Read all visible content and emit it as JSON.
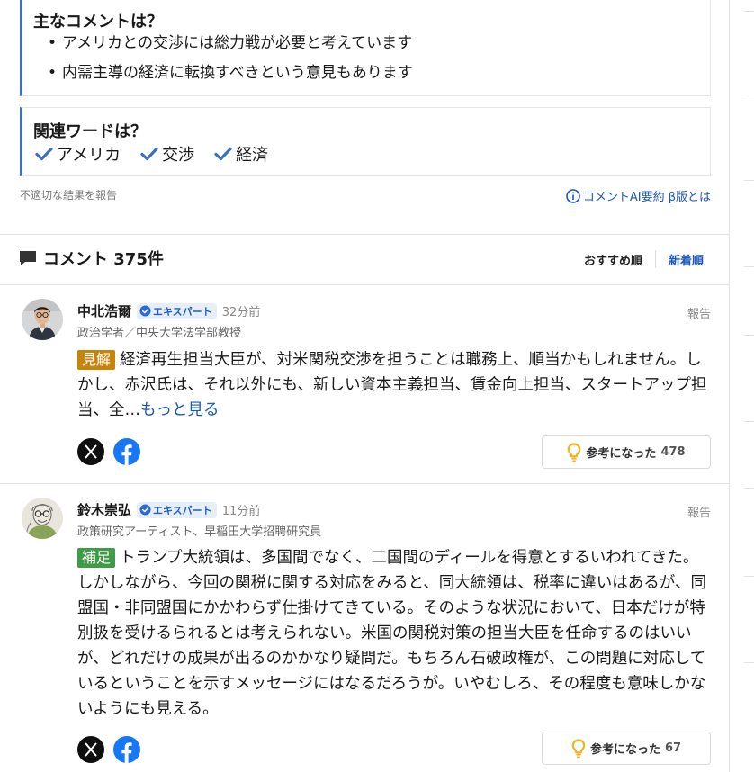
{
  "summary": {
    "main_comments_title": "主なコメントは？",
    "main_comments": [
      "アメリカとの交渉には総力戦が必要と考えています",
      "内需主導の経済に転換すべきという意見もあります"
    ],
    "related_words_title": "関連ワードは？",
    "related_words": [
      "アメリカ",
      "交渉",
      "経済"
    ],
    "report_inappropriate": "不適切な結果を報告",
    "ai_summary_link": "コメントAI要約 β版とは"
  },
  "comments_header": {
    "title": "コメント 375件",
    "sort_options": [
      "おすすめ順",
      "新着順"
    ],
    "active_sort": "新着順"
  },
  "comments": [
    {
      "name": "中北浩爾",
      "badge": "エキスパート",
      "time": "32分前",
      "affiliation": "政治学者／中央大学法学部教授",
      "report": "報告",
      "tag": "見解",
      "text": "経済再生担当大臣が、対米関税交渉を担うことは職務上、順当かもしれません。しかし、赤沢氏は、それ以外にも、新しい資本主義担当、賃金向上担当、スタートアップ担当、全…",
      "more": "もっと見る",
      "helpful_label": "参考になった",
      "helpful_count": "478"
    },
    {
      "name": "鈴木崇弘",
      "badge": "エキスパート",
      "time": "11分前",
      "affiliation": "政策研究アーティスト、早稲田大学招聘研究員",
      "report": "報告",
      "tag": "補足",
      "text": "トランプ大統領は、多国間でなく、二国間のディールを得意とするいわれてきた。しかしながら、今回の関税に関する対応をみると、同大統領は、税率に違いはあるが、同盟国・非同盟国にかかわらず仕掛けてきている。そのような状況において、日本だけが特別扱を受けるられるとは考えられない。米国の関税対策の担当大臣を任命するのはいいが、どれだけの成果が出るのかかなり疑問だ。もちろん石破政権が、この問題に対応しているということを示すメッセージにはなるだろうが。いやむしろ、その程度も意味しかないようにも見える。",
      "helpful_label": "参考になった",
      "helpful_count": "67"
    }
  ],
  "colors": {
    "accent": "#3d6fbe",
    "link": "#1b57b8",
    "tag_opinion": "#c7840a",
    "tag_supplement": "#3e9b48",
    "facebook": "#1877f2",
    "bulb": "#f2b320"
  },
  "icons": [
    "check-icon",
    "info-icon",
    "comment-icon",
    "verified-icon",
    "x-logo-icon",
    "facebook-icon",
    "lightbulb-icon"
  ]
}
